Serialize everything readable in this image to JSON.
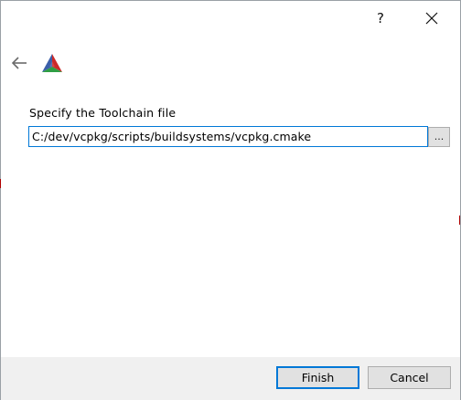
{
  "titlebar": {
    "help_label": "?",
    "close_icon": "close-icon"
  },
  "header": {
    "back_icon": "back-arrow-icon",
    "logo_icon": "cmake-logo-icon",
    "logo_colors": [
      "#3b5fa9",
      "#cc2929",
      "#2f9e44"
    ]
  },
  "main": {
    "label": "Specify the Toolchain file",
    "toolchain_path": "C:/dev/vcpkg/scripts/buildsystems/vcpkg.cmake",
    "browse_label": "..."
  },
  "footer": {
    "finish_label": "Finish",
    "cancel_label": "Cancel"
  },
  "colors": {
    "accent": "#0078d7",
    "footer_bg": "#f0f0f0",
    "button_bg": "#e1e1e1"
  }
}
